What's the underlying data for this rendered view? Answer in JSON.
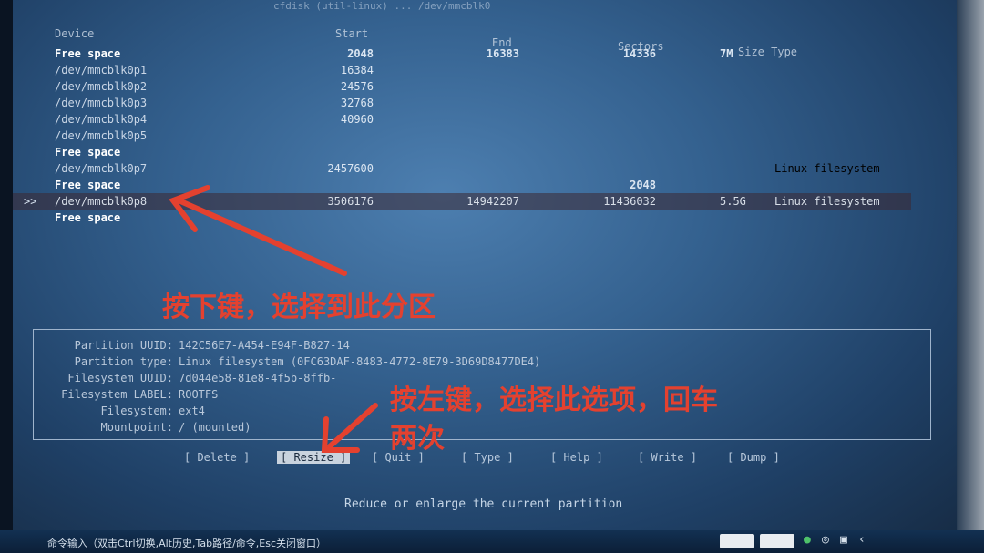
{
  "header": {
    "topline": "cfdisk (util-linux) ... /dev/mmcblk0",
    "device": "Device",
    "start": "Start",
    "end": "End",
    "sectors": "Sectors",
    "size_type": "Size Type"
  },
  "rows": [
    {
      "dev": "Free space",
      "start": "2048",
      "end": "16383",
      "sectors": "14336",
      "size": "7M",
      "type": "",
      "free": true
    },
    {
      "dev": "/dev/mmcblk0p1",
      "start": "16384",
      "end": "",
      "sectors": "",
      "size": "",
      "type": ""
    },
    {
      "dev": "/dev/mmcblk0p2",
      "start": "24576",
      "end": "",
      "sectors": "",
      "size": "",
      "type": ""
    },
    {
      "dev": "/dev/mmcblk0p3",
      "start": "32768",
      "end": "",
      "sectors": "",
      "size": "",
      "type": ""
    },
    {
      "dev": "/dev/mmcblk0p4",
      "start": "40960",
      "end": "",
      "sectors": "",
      "size": "",
      "type": ""
    },
    {
      "dev": "/dev/mmcblk0p5",
      "start": "",
      "end": "",
      "sectors": "",
      "size": "",
      "type": ""
    },
    {
      "dev": "Free space",
      "start": "",
      "end": "",
      "sectors": "",
      "size": "",
      "type": "",
      "free": true
    },
    {
      "dev": "/dev/mmcblk0p7",
      "start": "2457600",
      "end": "",
      "sectors": "",
      "size": "",
      "type": "Linux filesystem"
    },
    {
      "dev": "Free space",
      "start": "",
      "end": "",
      "sectors": "2048",
      "size": "",
      "type": "",
      "free": true
    },
    {
      "dev": "/dev/mmcblk0p8",
      "start": "3506176",
      "end": "14942207",
      "sectors": "11436032",
      "size": "5.5G",
      "type": "Linux filesystem",
      "selected": true
    },
    {
      "dev": "Free space",
      "start": "",
      "end": "",
      "sectors": "",
      "size": "",
      "type": "",
      "free": true
    }
  ],
  "pointer": ">>",
  "info": [
    {
      "k": "Partition UUID:",
      "v": "142C56E7-A454-E94F-B827-14"
    },
    {
      "k": "Partition type:",
      "v": "Linux filesystem (0FC63DAF-8483-4772-8E79-3D69D8477DE4)"
    },
    {
      "k": "Filesystem UUID:",
      "v": "7d044e58-81e8-4f5b-8ffb-"
    },
    {
      "k": "Filesystem LABEL:",
      "v": "ROOTFS"
    },
    {
      "k": "Filesystem:",
      "v": "ext4"
    },
    {
      "k": "Mountpoint:",
      "v": "/ (mounted)"
    }
  ],
  "menu": [
    {
      "label": "[ Delete ]",
      "active": false
    },
    {
      "label": "[ Resize ]",
      "active": true
    },
    {
      "label": "[ Quit ]",
      "active": false
    },
    {
      "label": "[ Type ]",
      "active": false
    },
    {
      "label": "[ Help ]",
      "active": false
    },
    {
      "label": "[ Write ]",
      "active": false
    },
    {
      "label": "[ Dump ]",
      "active": false
    }
  ],
  "hint": "Reduce or enlarge the current partition",
  "annotations": {
    "a1": "按下键，选择到此分区",
    "a2_line1": "按左键，选择此选项，回车",
    "a2_line2": "两次"
  },
  "taskbar": {
    "text": "命令输入（双击Ctrl切换,Alt历史,Tab路径/命令,Esc关闭窗口）"
  },
  "colors": {
    "accent": "#e4412f",
    "screen": "#34618f"
  }
}
